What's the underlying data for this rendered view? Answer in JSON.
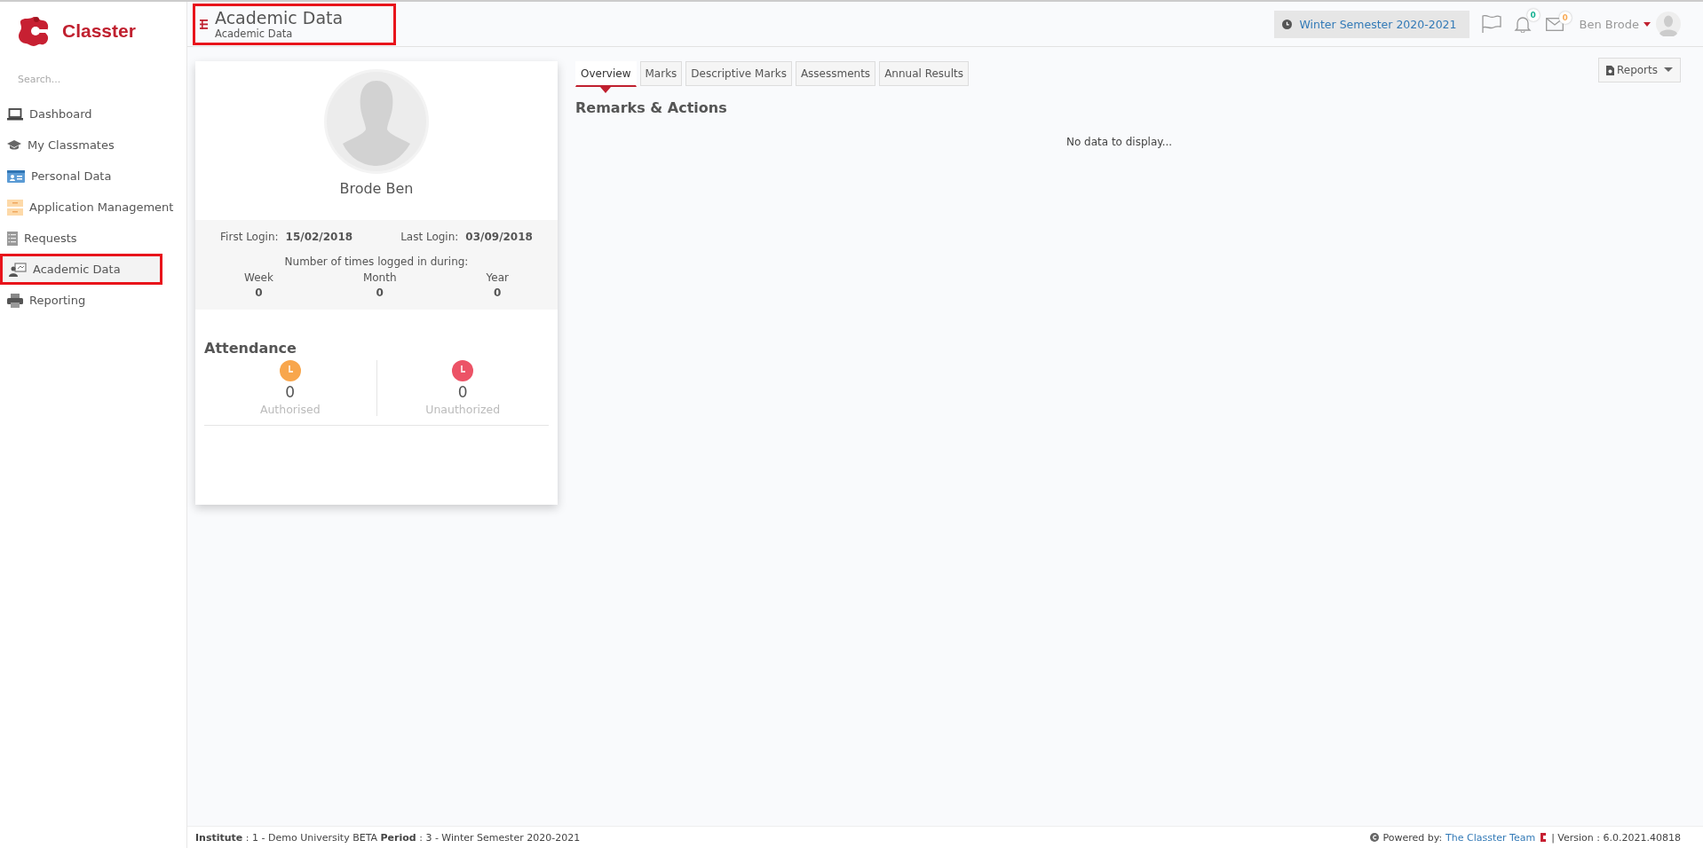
{
  "sidebar": {
    "brand": "Classter",
    "search": {
      "placeholder": "Search..."
    },
    "items": [
      {
        "label": "Dashboard",
        "selected": false,
        "highlighted": false
      },
      {
        "label": "My Classmates",
        "selected": false,
        "highlighted": false
      },
      {
        "label": "Personal Data",
        "selected": false,
        "highlighted": false
      },
      {
        "label": "Application Management",
        "selected": false,
        "highlighted": false
      },
      {
        "label": "Requests",
        "selected": false,
        "highlighted": false
      },
      {
        "label": "Academic Data",
        "selected": true,
        "highlighted": true
      },
      {
        "label": "Reporting",
        "selected": false,
        "highlighted": false
      }
    ]
  },
  "header": {
    "title": "Academic Data",
    "breadcrumb": "Academic Data",
    "highlighted": true,
    "period": "Winter Semester 2020-2021",
    "notifications": [
      {
        "count": "0",
        "color": "#1ab394"
      },
      {
        "count": "0",
        "color": "#f8ac59"
      }
    ],
    "user": "Ben Brode"
  },
  "profile": {
    "name": "Brode Ben",
    "first_login_label": "First Login:",
    "first_login": "15/02/2018",
    "last_login_label": "Last Login:",
    "last_login": "03/09/2018",
    "logins_caption": "Number of times logged in during:",
    "logins": [
      {
        "period": "Week",
        "count": "0"
      },
      {
        "period": "Month",
        "count": "0"
      },
      {
        "period": "Year",
        "count": "0"
      }
    ],
    "attendance_title": "Attendance",
    "attendance": [
      {
        "value": "0",
        "label": "Authorised",
        "color": "#f8a64c"
      },
      {
        "value": "0",
        "label": "Unauthorized",
        "color": "#ec5366"
      }
    ]
  },
  "tabs": [
    {
      "label": "Overview",
      "selected": true
    },
    {
      "label": "Marks",
      "selected": false
    },
    {
      "label": "Descriptive Marks",
      "selected": false
    },
    {
      "label": "Assessments",
      "selected": false
    },
    {
      "label": "Annual Results",
      "selected": false
    }
  ],
  "reports_button": "Reports",
  "section_title": "Remarks & Actions",
  "empty_message": "No data to display...",
  "footer": {
    "info": "**Institute** : 1 - Demo University BETA **Period** : 3 - Winter Semester 2020-2021",
    "powered_by": "Powered by:",
    "team_link": "The Classter Team",
    "version": "| Version : 6.0.2021.40818"
  }
}
